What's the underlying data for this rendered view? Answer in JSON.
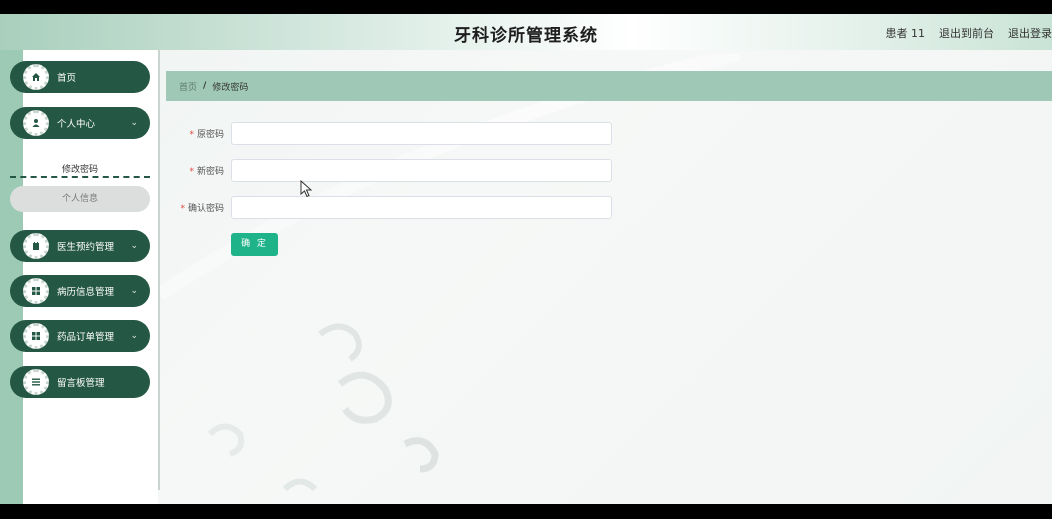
{
  "header": {
    "app_title": "牙科诊所管理系统",
    "user_label": "患者 11",
    "frontend_link": "退出到前台",
    "logout_link": "退出登录"
  },
  "sidebar": {
    "items": [
      {
        "label": "首页",
        "icon": "home-icon"
      },
      {
        "label": "个人中心",
        "icon": "user-icon"
      },
      {
        "label": "医生预约管理",
        "icon": "calendar-icon"
      },
      {
        "label": "病历信息管理",
        "icon": "grid-icon"
      },
      {
        "label": "药品订单管理",
        "icon": "grid-icon"
      },
      {
        "label": "留言板管理",
        "icon": "list-icon"
      }
    ],
    "submenu": {
      "active": "修改密码",
      "other": "个人信息"
    }
  },
  "breadcrumb": {
    "home": "首页",
    "separator": "/",
    "current": "修改密码"
  },
  "form": {
    "old_password_label": "原密码",
    "new_password_label": "新密码",
    "confirm_password_label": "确认密码",
    "required_mark": "*",
    "old_password_value": "",
    "new_password_value": "",
    "confirm_password_value": "",
    "submit_label": "确 定"
  },
  "colors": {
    "sidebar_item": "#255844",
    "accent": "#1fb38a",
    "breadcrumb_bg": "#9fc9b6",
    "required": "#e0463f"
  }
}
